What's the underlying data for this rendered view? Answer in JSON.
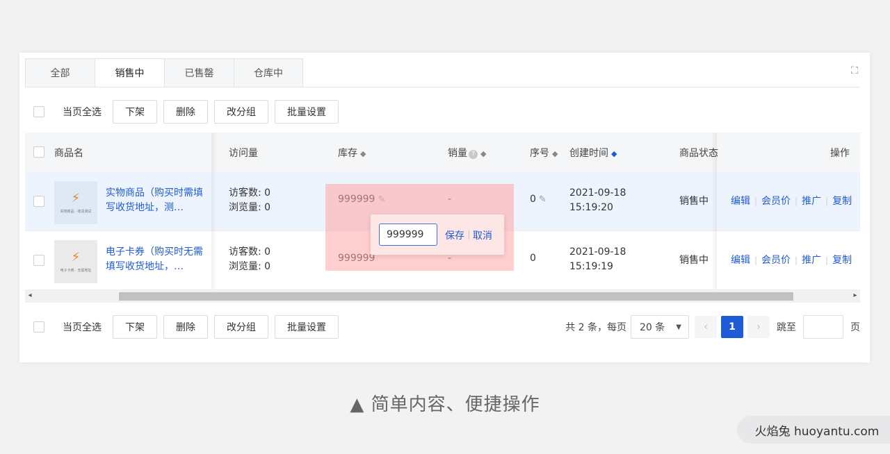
{
  "tabs": [
    "全部",
    "销售中",
    "已售罄",
    "仓库中"
  ],
  "active_tab": "销售中",
  "bulk": {
    "select_all": "当页全选",
    "buttons": [
      "下架",
      "删除",
      "改分组",
      "批量设置"
    ]
  },
  "columns": {
    "name": "商品名",
    "visits": "访问量",
    "stock": "库存",
    "sales": "销量",
    "seq": "序号",
    "created": "创建时间",
    "status": "商品状态",
    "ops": "操作"
  },
  "rows": [
    {
      "name": "实物商品（购买时需填写收货地址，测…",
      "thumb_label": "实物商品 · 收货测试",
      "visitors": "访客数: 0",
      "views": "浏览量: 0",
      "stock": "999999",
      "sales": "-",
      "seq": "0",
      "created_date": "2021-09-18",
      "created_time": "15:19:20",
      "status": "销售中",
      "ops": [
        "编辑",
        "会员价",
        "推广",
        "复制"
      ]
    },
    {
      "name": "电子卡券（购买时无需填写收货地址，…",
      "thumb_label": "电子卡券 · 无需地址",
      "visitors": "访客数: 0",
      "views": "浏览量: 0",
      "stock": "999999",
      "sales": "-",
      "seq": "0",
      "created_date": "2021-09-18",
      "created_time": "15:19:19",
      "status": "销售中",
      "ops": [
        "编辑",
        "会员价",
        "推广",
        "复制"
      ]
    }
  ],
  "popover": {
    "value": "999999",
    "save": "保存",
    "cancel": "取消"
  },
  "pagination": {
    "total": "共 2 条，每页",
    "per_page": "20 条",
    "current": "1",
    "jump_label": "跳至",
    "page_suffix": "页"
  },
  "caption": "▲ 简单内容、便捷操作",
  "watermark": "火焰兔 huoyantu.com",
  "colors": {
    "accent": "#1f5bd6",
    "highlight": "#ffa5a5",
    "row_selected": "#eef4fd"
  }
}
